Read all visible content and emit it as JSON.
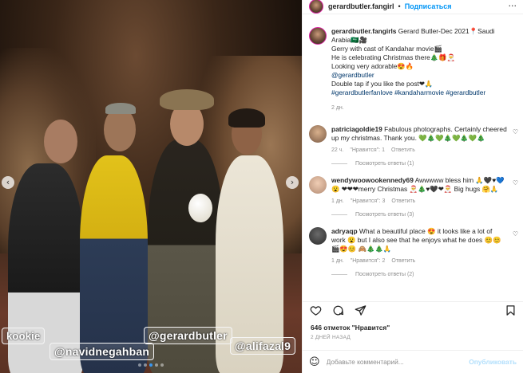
{
  "photo": {
    "tags": [
      "kookie",
      "@navidnegahban",
      "@gerardbutler",
      "@alifazal9"
    ],
    "carousel_dots": 5,
    "active_dot": 2
  },
  "header": {
    "username": "gerardbutler.fangirl",
    "bullet": "•",
    "follow_label": "Подписаться",
    "more": "···"
  },
  "caption": {
    "username": "gerardbutler.fangirls",
    "lines": [
      "Gerard Butler-Dec 2021📍Saudi Arabia🇸🇦🎥",
      "Gerry with cast of Kandahar movie🎬",
      "He is celebrating Christmas there🎄🎁🎅",
      "Looking very adorable😍🔥",
      "@gerardbutler",
      "Double tap if you like the post❤🙏",
      "#gerardbutlerfanlove #kandaharmovie #gerardbutler"
    ],
    "time": "2 дн."
  },
  "comments": [
    {
      "username": "patriciagoldie19",
      "text": "Fabulous photographs. Certainly cheered up my christmas. Thank you. 💚🎄💚🎄💚🎄💚🎄",
      "time": "22 ч.",
      "likes": "\"Нравится\": 1",
      "reply": "Ответить",
      "view_replies": "Посмотреть ответы (1)"
    },
    {
      "username": "wendywoowookennedy69",
      "text": "Awwwww bless him 🙏🖤♥💙😮 ❤❤❤merry Christmas 🎅🎄♥🖤❤🎅 Big hugs 🤗🙏",
      "time": "1 дн.",
      "likes": "\"Нравится\": 3",
      "reply": "Ответить",
      "view_replies": "Посмотреть ответы (3)"
    },
    {
      "username": "adryaqp",
      "text": "What a beautiful place 😍 it looks like a lot of work 😮 but I also see that he enjoys what he does 😊😊🎬😍😊 🙈🎄🎄🙏",
      "time": "1 дн.",
      "likes": "\"Нравится\": 2",
      "reply": "Ответить",
      "view_replies": "Посмотреть ответы (2)"
    }
  ],
  "post": {
    "likes": "646 отметок \"Нравится\"",
    "date": "2 ДНЕЙ НАЗАД"
  },
  "comment_box": {
    "placeholder": "Добавьте комментарий...",
    "publish_label": "Опубликовать"
  },
  "colors": {
    "link": "#0095f6",
    "hashtag": "#00376b",
    "muted": "#8e8e8e",
    "text": "#262626"
  }
}
